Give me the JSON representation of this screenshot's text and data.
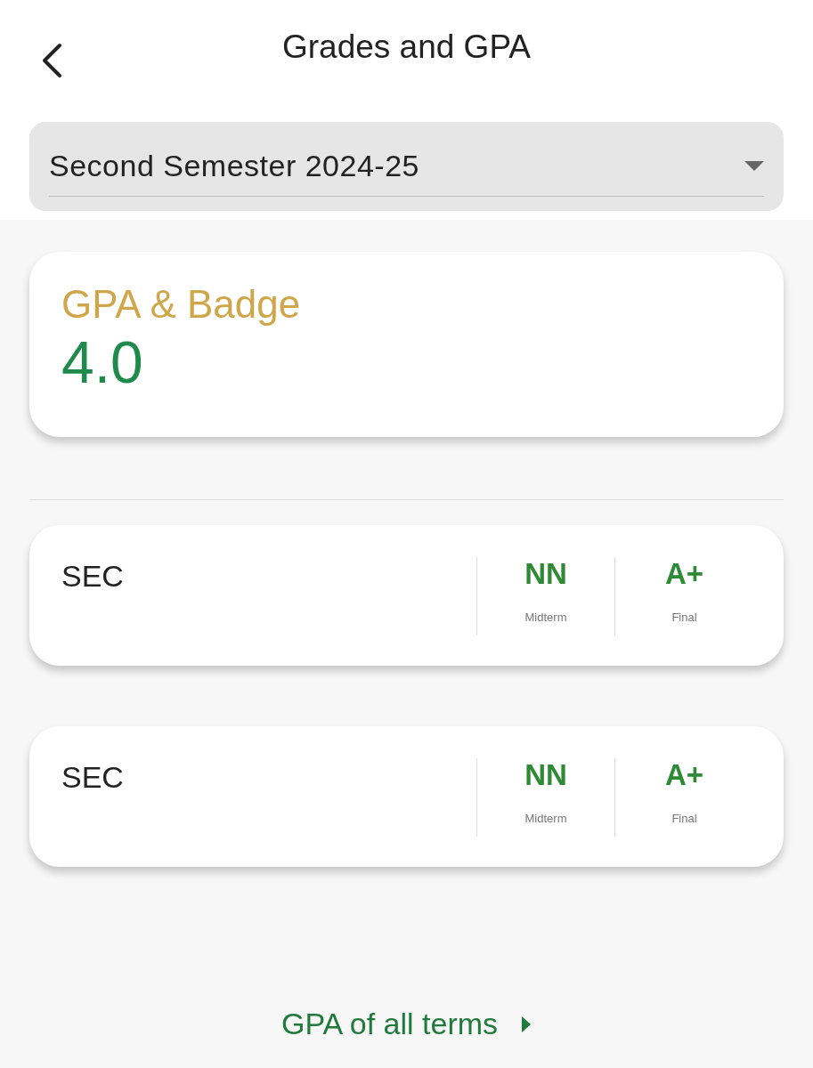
{
  "header": {
    "title": "Grades and GPA"
  },
  "term_select": {
    "value": "Second Semester 2024-25"
  },
  "gpa_card": {
    "title": "GPA & Badge",
    "value": "4.0"
  },
  "courses": [
    {
      "name": "SEC",
      "grades": [
        {
          "value": "NN",
          "label": "Midterm"
        },
        {
          "value": "A+",
          "label": "Final"
        }
      ]
    },
    {
      "name": "SEC",
      "grades": [
        {
          "value": "NN",
          "label": "Midterm"
        },
        {
          "value": "A+",
          "label": "Final"
        }
      ]
    }
  ],
  "footer_link": {
    "label": "GPA of all terms"
  }
}
